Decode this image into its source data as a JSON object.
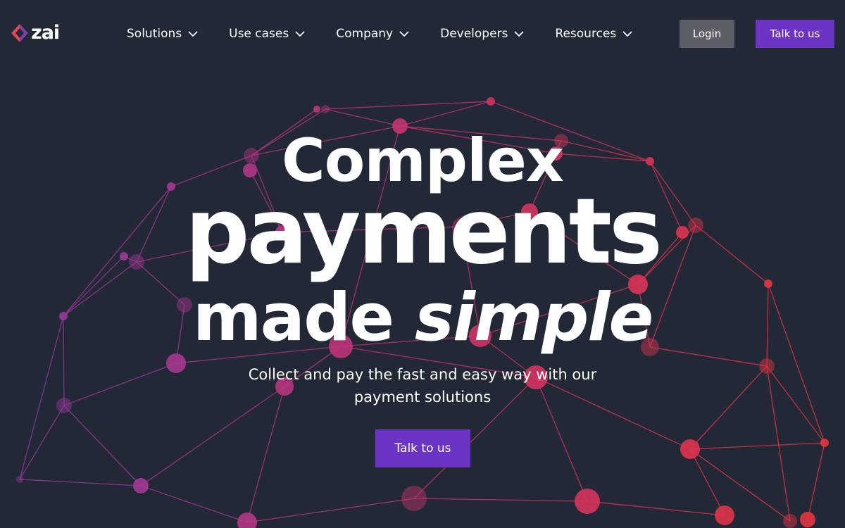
{
  "brand": {
    "name": "zai",
    "logo_colors": [
      "#e0455a",
      "#7d3fa8"
    ]
  },
  "nav": {
    "items": [
      {
        "label": "Solutions",
        "icon": "chevron-down-icon"
      },
      {
        "label": "Use cases",
        "icon": "chevron-down-icon"
      },
      {
        "label": "Company",
        "icon": "chevron-down-icon"
      },
      {
        "label": "Developers",
        "icon": "chevron-down-icon"
      },
      {
        "label": "Resources",
        "icon": "chevron-down-icon"
      }
    ],
    "login_label": "Login",
    "talk_label": "Talk to us"
  },
  "hero": {
    "line1": "Complex",
    "line2": "payments",
    "line3_plain": "made ",
    "line3_italic": "simple",
    "subtitle": "Collect and pay the fast and easy way with our payment solutions",
    "cta_label": "Talk to us"
  },
  "colors": {
    "background": "#232836",
    "primary_button": "#6b34c4",
    "login_button": "#5c5f68",
    "network_warm": "#e8353c",
    "network_mid": "#c9336e",
    "network_cool": "#8e3aa6"
  }
}
